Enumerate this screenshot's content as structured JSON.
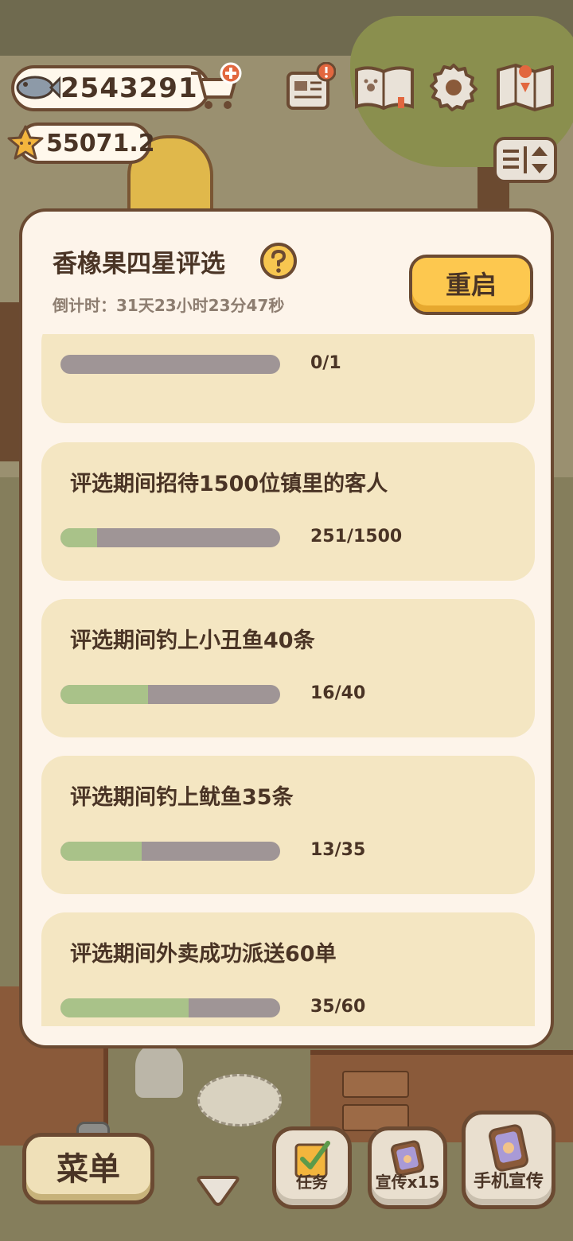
{
  "hud": {
    "coins": "2543291",
    "stars": "55071.2"
  },
  "modal": {
    "title": "香橡果四星评选",
    "countdown": "倒计时：31天23小时23分47秒",
    "restart_label": "重启"
  },
  "tasks": [
    {
      "label": "",
      "progress": "0/1",
      "fraction": 0
    },
    {
      "label": "评选期间招待1500位镇里的客人",
      "progress": "251/1500",
      "fraction": 0.167
    },
    {
      "label": "评选期间钓上小丑鱼40条",
      "progress": "16/40",
      "fraction": 0.4
    },
    {
      "label": "评选期间钓上鱿鱼35条",
      "progress": "13/35",
      "fraction": 0.371
    },
    {
      "label": "评选期间外卖成功派送60单",
      "progress": "35/60",
      "fraction": 0.583
    }
  ],
  "bottom": {
    "menu_label": "菜单",
    "task_label": "任务",
    "promo_label": "宣传x15",
    "phone_label": "手机宣传"
  },
  "colors": {
    "accent": "#fdc84f",
    "progress_fill": "#a9c289",
    "progress_track": "#9f9596",
    "card": "#f4e6c2",
    "text": "#4a3425"
  }
}
